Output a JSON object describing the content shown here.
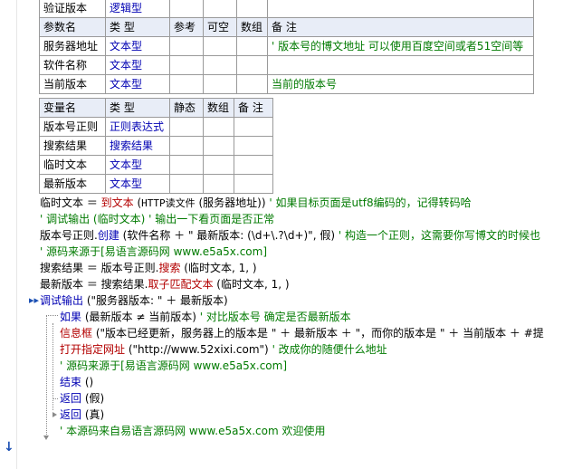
{
  "table1": {
    "top_row": [
      "验证版本",
      "逻辑型"
    ],
    "headers": [
      "参数名",
      "类 型",
      "参考",
      "可空",
      "数组",
      "备 注"
    ],
    "rows": [
      {
        "name": "服务器地址",
        "type": "文本型",
        "note": "' 版本号的博文地址 可以使用百度空间或者51空间等"
      },
      {
        "name": "软件名称",
        "type": "文本型",
        "note": ""
      },
      {
        "name": "当前版本",
        "type": "文本型",
        "note": "当前的版本号"
      }
    ]
  },
  "table2": {
    "headers": [
      "变量名",
      "类 型",
      "静态",
      "数组",
      "备 注"
    ],
    "rows": [
      {
        "name": "版本号正则",
        "type": "正则表达式"
      },
      {
        "name": "搜索结果",
        "type": "搜索结果"
      },
      {
        "name": "临时文本",
        "type": "文本型"
      },
      {
        "name": "最新版本",
        "type": "文本型"
      }
    ]
  },
  "code": {
    "l1": {
      "a": "临时文本 ＝ ",
      "b": "到文本",
      "c": " (",
      "d": "HTTP读文件",
      "e": " (服务器地址)) ",
      "f": "' 如果目标页面是utf8编码的，记得转码哈"
    },
    "l2": {
      "a": "' 调试输出 (临时文本) ' 输出一下看页面是否正常"
    },
    "l3": {
      "a": "版本号正则.",
      "b": "创建",
      "c": " (软件名称 ＋ \" 最新版本: (\\d+\\.?\\d+)\", 假) ",
      "d": "' 构造一个正则，这需要你写博文的时候也"
    },
    "l4": {
      "a": "' 源码来源于[易语言源码网 www.e5a5x.com]"
    },
    "l5": {
      "a": "搜索结果 ＝ 版本号正则.",
      "b": "搜索",
      "c": " (临时文本, 1, )"
    },
    "l6": {
      "a": "最新版本 ＝ 搜索结果.",
      "b": "取子匹配文本",
      "c": " (临时文本, 1, )"
    },
    "l7": {
      "a": "调试输出",
      "b": " (\"服务器版本: \" ＋ 最新版本)"
    },
    "l8": {
      "a": "如果",
      "b": " (最新版本 ≠ 当前版本) ",
      "c": "' 对比版本号 确定是否最新版本"
    },
    "l9": {
      "a": "信息框",
      "b": " (\"版本已经更新，服务器上的版本是 \" ＋ 最新版本 ＋ \"，而你的版本是 \" ＋ 当前版本 ＋ #提"
    },
    "l10": {
      "a": "打开指定网址",
      "b": " (\"http://www.52xixi.com\") ",
      "c": "' 改成你的随便什么地址"
    },
    "l11": {
      "a": "' 源码来源于[易语言源码网 www.e5a5x.com]"
    },
    "l12": {
      "a": "结束",
      "b": " ()"
    },
    "l13": {
      "a": "返回",
      "b": " (假)"
    },
    "l14": {
      "a": "返回",
      "b": " (真)"
    },
    "l15": {
      "a": "' 本源码来自易语言源码网 www.e5a5x.com  欢迎使用"
    }
  }
}
